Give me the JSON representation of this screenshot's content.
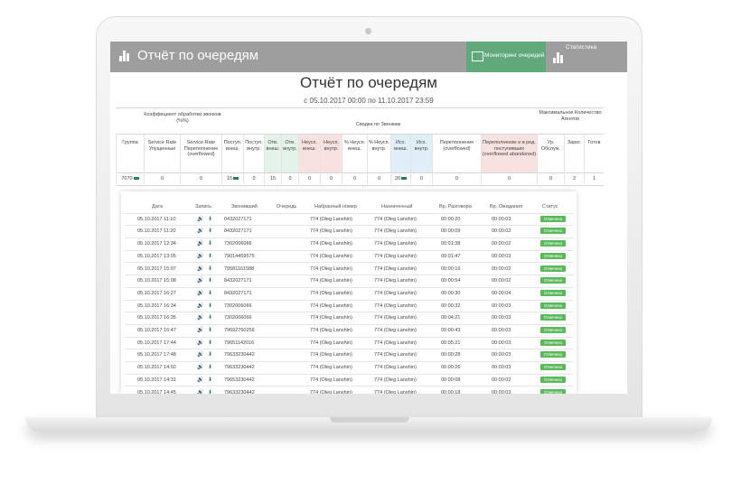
{
  "header": {
    "title": "Отчёт по очередям",
    "monitoring_label": "Мониторинг очередей",
    "stats_label": "Статистика"
  },
  "report": {
    "title": "Отчёт по очередям",
    "period": "с 05.10.2017 00:00 по 11.10.2017 23:59"
  },
  "summary": {
    "groups": {
      "sla": "Коэффициент обработки звонков (%%)",
      "calls": "Сводка по Звонкам",
      "agents": "Максимальное Количество Агентов"
    },
    "columns": [
      "Группа",
      "Service Rate Упущенные",
      "Service Rate Переполнение (overflowed)",
      "Поступ. внеш.",
      "Поступ. внутр.",
      "Отв. внеш.",
      "Отв. внутр.",
      "Неусп. внеш.",
      "Неусп. внутр.",
      "% Неусп. внеш.",
      "% Неусп. внутр.",
      "Исх. внеш.",
      "Исх. внутр.",
      "Переполнение (overflowed)",
      "Переполнение и в ред. поступивших (overflowed abandoned)",
      "Ур. Обслуж.",
      "Зарег.",
      "Готов"
    ],
    "values": [
      "7070",
      "0",
      "0",
      "15",
      "0",
      "15",
      "0",
      "0",
      "0",
      "0",
      "0",
      "20",
      "0",
      "0",
      "0",
      "0",
      "2",
      "1"
    ]
  },
  "calls": {
    "headers": [
      "Дата",
      "Запись",
      "Звонивший",
      "Очередь",
      "Набранный номер",
      "Назначенный",
      "Вр. Разговора",
      "Вр. Ожидания",
      "Статус"
    ],
    "rows": [
      {
        "date": "05.10.2017 11:10",
        "caller": "0432027171",
        "dialed": "774 (Oleg Lanshin)",
        "dest": "774 (Oleg Lanshin)",
        "talk": "00:00:20",
        "wait": "00:00:03",
        "status": "Отвечено"
      },
      {
        "date": "05.10.2017 11:20",
        "caller": "8432027171",
        "dialed": "774 (Oleg Lanshin)",
        "dest": "774 (Oleg Lanshin)",
        "talk": "00:00:09",
        "wait": "00:00:02",
        "status": "Отвечено"
      },
      {
        "date": "05.10.2017 12:34",
        "caller": "7302006066",
        "dialed": "774 (Oleg Lanshin)",
        "dest": "774 (Oleg Lanshin)",
        "talk": "00:01:38",
        "wait": "00:00:02",
        "status": "Отвечено"
      },
      {
        "date": "05.10.2017 13:05",
        "caller": "79014459575",
        "dialed": "774 (Oleg Lanshin)",
        "dest": "774 (Oleg Lanshin)",
        "talk": "00:01:47",
        "wait": "00:00:03",
        "status": "Отвечено"
      },
      {
        "date": "05.10.2017 15:07",
        "caller": "79581161588",
        "dialed": "774 (Oleg Lanshin)",
        "dest": "774 (Oleg Lanshin)",
        "talk": "00:00:16",
        "wait": "00:00:02",
        "status": "Отвечено"
      },
      {
        "date": "05.10.2017 15:08",
        "caller": "8432027171",
        "dialed": "774 (Oleg Lanshin)",
        "dest": "774 (Oleg Lanshin)",
        "talk": "00:00:54",
        "wait": "00:00:02",
        "status": "Отвечено"
      },
      {
        "date": "05.10.2017 16:27",
        "caller": "8432027171",
        "dialed": "774 (Oleg Lanshin)",
        "dest": "774 (Oleg Lanshin)",
        "talk": "00:00:30",
        "wait": "00:00:04",
        "status": "Отвечено"
      },
      {
        "date": "05.10.2017 16:34",
        "caller": "7302006066",
        "dialed": "774 (Oleg Lanshin)",
        "dest": "774 (Oleg Lanshin)",
        "talk": "00:00:32",
        "wait": "00:00:03",
        "status": "Отвечено"
      },
      {
        "date": "05.10.2017 16:35",
        "caller": "7302006066",
        "dialed": "774 (Oleg Lanshin)",
        "dest": "774 (Oleg Lanshin)",
        "talk": "00:04:21",
        "wait": "00:00:03",
        "status": "Отвечено"
      },
      {
        "date": "05.10.2017 16:47",
        "caller": "79692760256",
        "dialed": "774 (Oleg Lanshin)",
        "dest": "774 (Oleg Lanshin)",
        "talk": "00:00:43",
        "wait": "00:00:03",
        "status": "Отвечено"
      },
      {
        "date": "05.10.2017 17:44",
        "caller": "79651142016",
        "dialed": "774 (Oleg Lanshin)",
        "dest": "774 (Oleg Lanshin)",
        "talk": "00:05:21",
        "wait": "00:00:03",
        "status": "Отвечено"
      },
      {
        "date": "05.10.2017 17:48",
        "caller": "79633230442",
        "dialed": "774 (Oleg Lanshin)",
        "dest": "774 (Oleg Lanshin)",
        "talk": "00:00:28",
        "wait": "00:00:03",
        "status": "Отвечено"
      },
      {
        "date": "05.10.2017 14:02",
        "caller": "79633230442",
        "dialed": "774 (Oleg Lanshin)",
        "dest": "774 (Oleg Lanshin)",
        "talk": "00:00:26",
        "wait": "00:00:03",
        "status": "Отвечено"
      },
      {
        "date": "05.10.2017 14:31",
        "caller": "79653230442",
        "dialed": "774 (Oleg Lanshin)",
        "dest": "774 (Oleg Lanshin)",
        "talk": "00:00:08",
        "wait": "00:00:02",
        "status": "Отвечено"
      },
      {
        "date": "05.10.2017 14:45",
        "caller": "79633230442",
        "dialed": "774 (Oleg Lanshin)",
        "dest": "774 (Oleg Lanshin)",
        "talk": "00:00:18",
        "wait": "00:00:03",
        "status": "Отвечено"
      }
    ]
  }
}
